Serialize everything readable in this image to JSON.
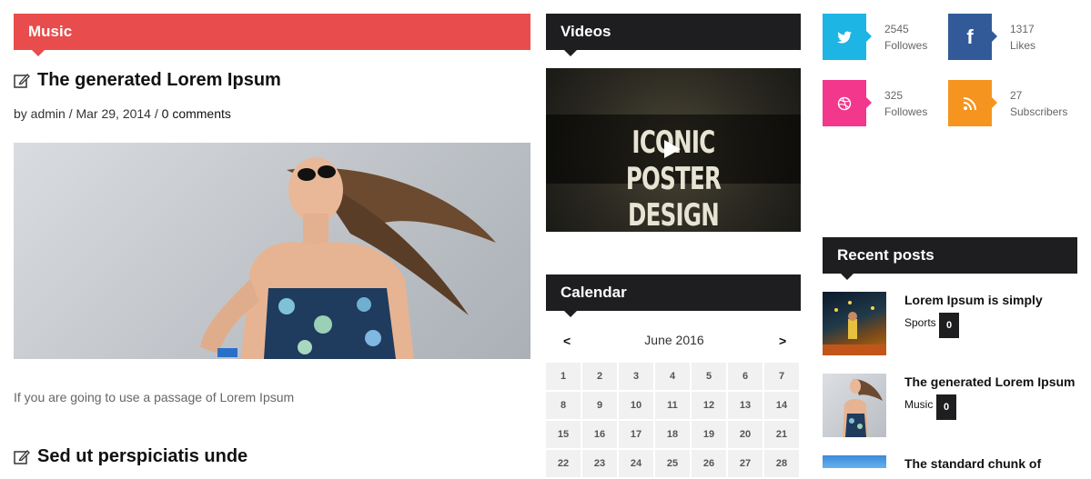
{
  "music": {
    "heading": "Music",
    "post1": {
      "title": "The generated Lorem Ipsum",
      "meta_prefix": "by admin / Mar 29, 2014 / ",
      "comments": "0 comments",
      "excerpt": "If you are going to use a passage of Lorem Ipsum"
    },
    "post2": {
      "title": "Sed ut perspiciatis unde"
    }
  },
  "videos": {
    "heading": "Videos",
    "video_title": "ICONIC POSTER DESIGN"
  },
  "calendar": {
    "heading": "Calendar",
    "prev": "<",
    "month": "June 2016",
    "next": ">",
    "weeks": [
      [
        "1",
        "2",
        "3",
        "4",
        "5",
        "6",
        "7"
      ],
      [
        "8",
        "9",
        "10",
        "11",
        "12",
        "13",
        "14"
      ],
      [
        "15",
        "16",
        "17",
        "18",
        "19",
        "20",
        "21"
      ],
      [
        "22",
        "23",
        "24",
        "25",
        "26",
        "27",
        "28"
      ]
    ]
  },
  "social": [
    {
      "icon": "twitter-icon",
      "glyph": "t",
      "count": "2545",
      "label": "Followes",
      "color": "#1cb5e4"
    },
    {
      "icon": "facebook-icon",
      "glyph": "f",
      "count": "1317",
      "label": "Likes",
      "color": "#325a98"
    },
    {
      "icon": "dribbble-icon",
      "glyph": "◎",
      "count": "325",
      "label": "Followes",
      "color": "#f2378c"
    },
    {
      "icon": "rss-icon",
      "glyph": "◔",
      "count": "27",
      "label": "Subscribers",
      "color": "#f5951f"
    }
  ],
  "recent": {
    "heading": "Recent posts",
    "items": [
      {
        "title": "Lorem Ipsum is simply",
        "category": "Sports",
        "count": "0"
      },
      {
        "title": "The generated Lorem Ipsum",
        "category": "Music",
        "count": "0"
      },
      {
        "title": "The standard chunk of",
        "category": "",
        "count": ""
      }
    ]
  }
}
